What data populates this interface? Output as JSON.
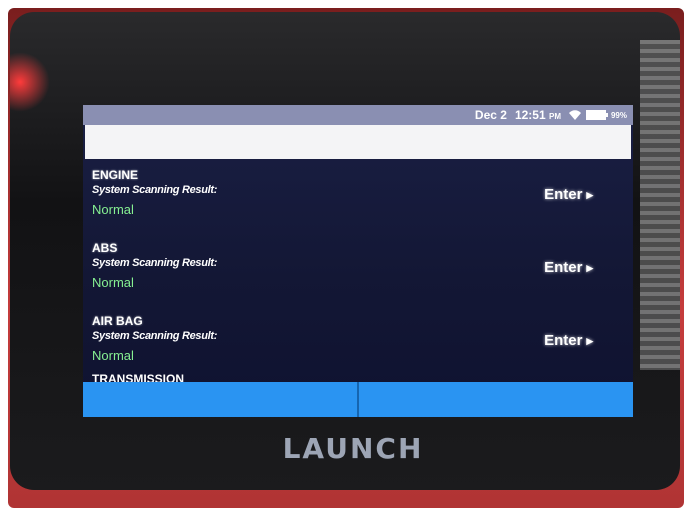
{
  "status_bar": {
    "date": "Dec 2",
    "time": "12:51",
    "time_suffix": "PM",
    "battery_text": "99%",
    "battery_level": 0.99,
    "icons": [
      "wifi-icon",
      "battery-icon"
    ]
  },
  "systems": [
    {
      "name": "ENGINE",
      "result_label": "System Scanning Result:",
      "result": "Normal",
      "action": "Enter",
      "action_icon": "chevron-right-icon"
    },
    {
      "name": "ABS",
      "result_label": "System Scanning Result:",
      "result": "Normal",
      "action": "Enter",
      "action_icon": "chevron-right-icon"
    },
    {
      "name": "AIR BAG",
      "result_label": "System Scanning Result:",
      "result": "Normal",
      "action": "Enter",
      "action_icon": "chevron-right-icon"
    }
  ],
  "partial_item": "TRANSMISSION",
  "device_brand": "LAUNCH",
  "colors": {
    "accent": "#2a94f2",
    "status_normal": "#86f092",
    "screen_bg": "#131735",
    "casing": "#c53c3c"
  }
}
